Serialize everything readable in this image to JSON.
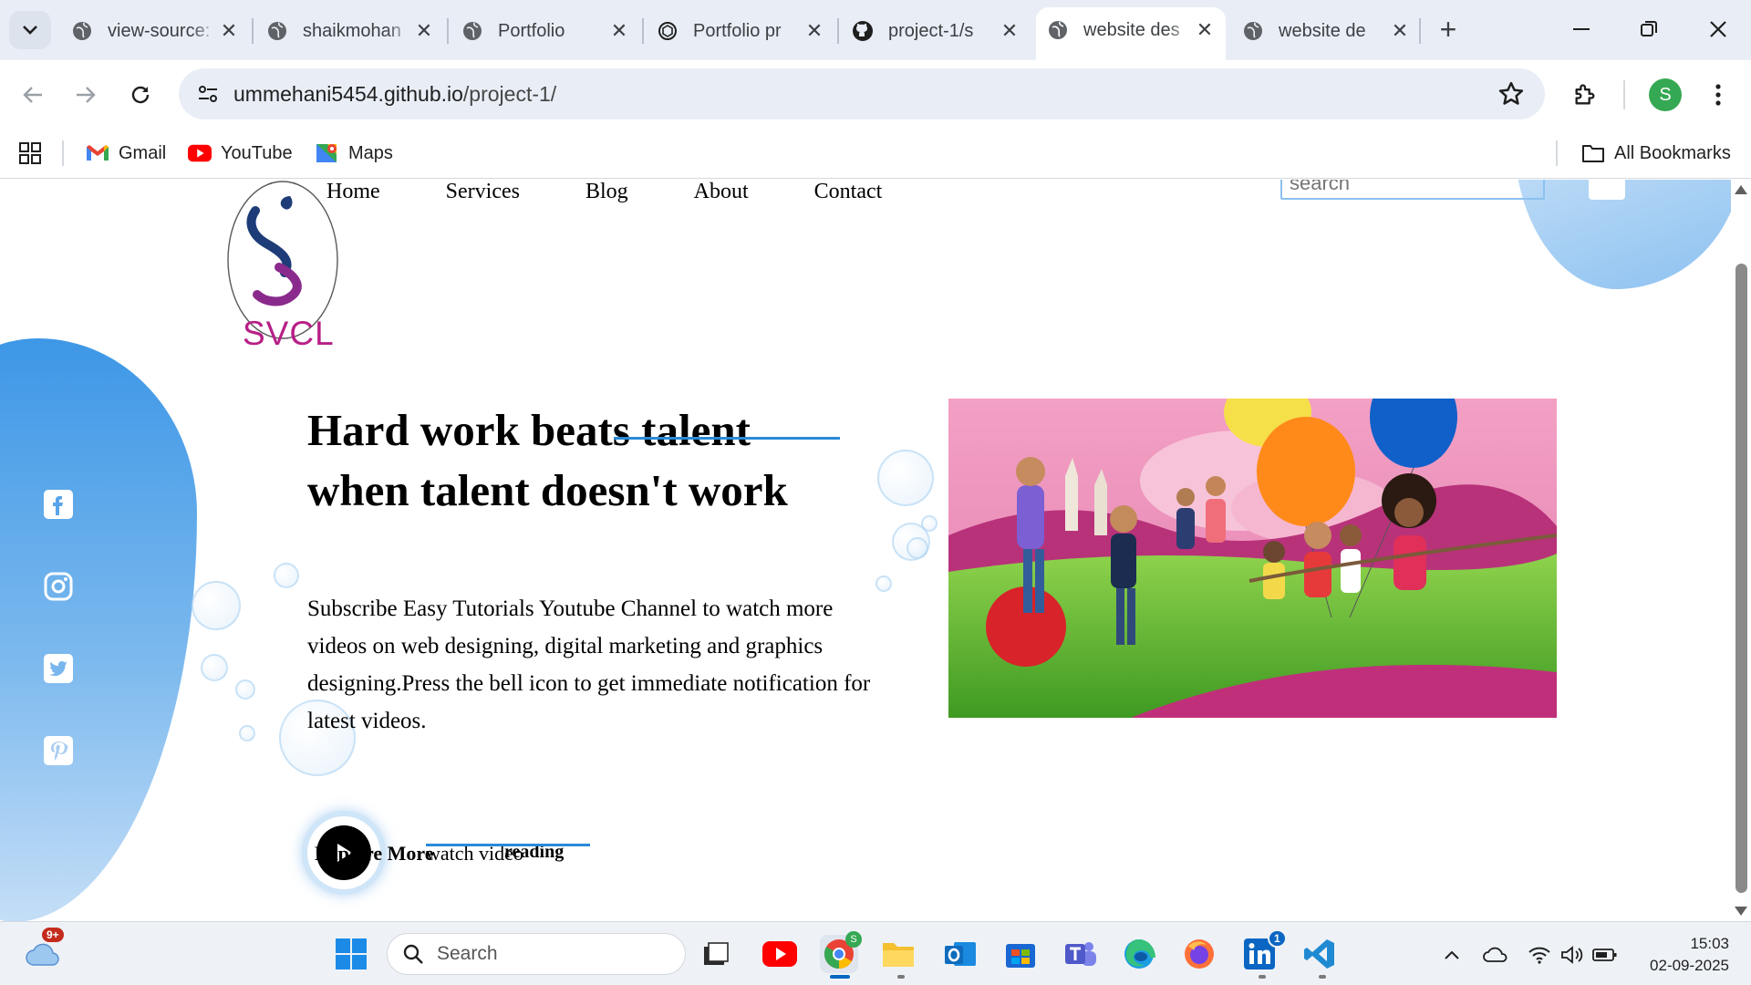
{
  "browser": {
    "tabs": [
      {
        "title": "view-source:",
        "icon": "globe-icon",
        "active": false
      },
      {
        "title": "shaikmohan",
        "icon": "globe-icon",
        "active": false
      },
      {
        "title": "Portfolio",
        "icon": "globe-icon",
        "active": false
      },
      {
        "title": "Portfolio pr",
        "icon": "chatgpt-icon",
        "active": false
      },
      {
        "title": "project-1/s",
        "icon": "github-icon",
        "active": false
      },
      {
        "title": "website des",
        "icon": "globe-icon",
        "active": true
      },
      {
        "title": "website de",
        "icon": "globe-icon",
        "active": false
      }
    ],
    "address": {
      "domain": "ummehani5454.github.io",
      "path": "/project-1/"
    },
    "profile_initial": "S",
    "bookmarks": [
      {
        "label": "Gmail",
        "icon": "gmail-icon"
      },
      {
        "label": "YouTube",
        "icon": "youtube-icon"
      },
      {
        "label": "Maps",
        "icon": "maps-icon"
      }
    ],
    "all_bookmarks_label": "All Bookmarks"
  },
  "page": {
    "logo_text": "SVCL",
    "nav": [
      "Home",
      "Services",
      "Blog",
      "About",
      "Contact"
    ],
    "search_placeholder": "search",
    "headline_line1": "Hard work beats talent",
    "headline_line2": "when talent doesn't work",
    "paragraph": "Subscribe Easy Tutorials Youtube Channel to watch more videos on web designing, digital marketing and graphics designing.Press the bell icon to get immediate notification for latest videos.",
    "cta_explore": "Explore More",
    "cta_watch": "watch video",
    "cta_reading": "reading",
    "social_icons": [
      "facebook-icon",
      "instagram-icon",
      "twitter-icon",
      "pinterest-icon"
    ],
    "colors": {
      "accent": "#2b8ad8",
      "blob": "#3d97e6"
    }
  },
  "taskbar": {
    "search_label": "Search",
    "weather_badge": "9+",
    "linkedin_badge": "1",
    "chrome_badge": "S",
    "time": "15:03",
    "date": "02-09-2025"
  }
}
